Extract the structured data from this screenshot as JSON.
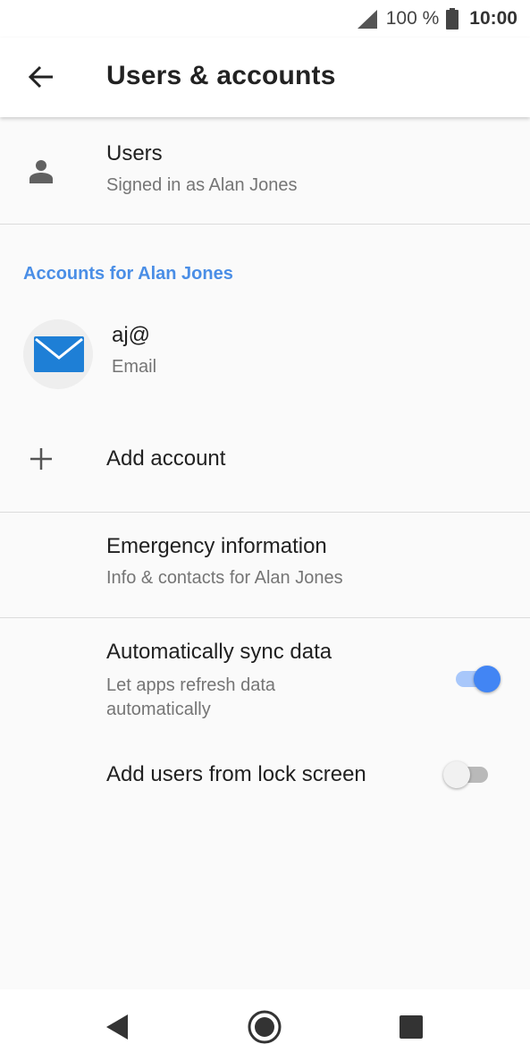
{
  "status_bar": {
    "battery": "100 %",
    "time": "10:00"
  },
  "app_bar": {
    "title": "Users & accounts"
  },
  "users_row": {
    "title": "Users",
    "subtitle": "Signed in as Alan Jones"
  },
  "accounts_section": {
    "header": "Accounts for Alan Jones",
    "account": {
      "name": "aj@",
      "type": "Email"
    },
    "add_account": "Add account"
  },
  "emergency_row": {
    "title": "Emergency information",
    "subtitle": "Info & contacts for Alan Jones"
  },
  "sync_row": {
    "title": "Automatically sync data",
    "subtitle_line1": "Let apps refresh data",
    "subtitle_line2": "automatically",
    "enabled": true
  },
  "lock_screen_row": {
    "title": "Add users from lock screen",
    "enabled": false
  },
  "colors": {
    "accent": "#4285f4",
    "accent_track": "#a8c7fa",
    "section_header": "#4a8ee6",
    "email_icon": "#1e7fd6"
  },
  "nav_bar": {
    "back_icon": "back-triangle-icon",
    "home_icon": "home-circle-icon",
    "recents_icon": "recents-square-icon"
  }
}
